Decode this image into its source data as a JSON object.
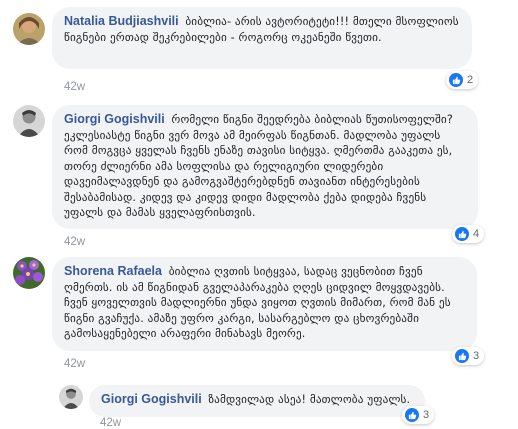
{
  "comments": [
    {
      "author": "Natalia Budjiashvili",
      "text": "ბიბლია- არის ავტორიტეტი!!! მთელი მსოფლიოს წიგნები ერთად შეკრებილები - როგორც ოკეანეში წვეთი.",
      "reaction_count": "2",
      "time": "42w"
    },
    {
      "author": "Giorgi Gogishvili",
      "text": "რომელი წიგნი შეედრება ბიბლიას წუთისოფელში? ეკლესიასტე წიგნი ვერ მოვა ამ მეირფას წიგნთან. მადლობა უფალს რომ მოგვცა ყველას ჩვენს ენაზე თავისი სიტყვა. ღმერთმა გააკეთა ეს, თორე ძლიერნი ამა სოფლისა და რელიგიური ლიდერები დავეიმალავდნენ და გამოგვაშტერებდნენ თავიანთ ინტერესების შესაბამისად. კიდევ და კიდევ დიდი მადლობა ქება დიდება ჩვენს უფალს და მამას ყველაფრისთვის.",
      "reaction_count": "4",
      "time": "42w"
    },
    {
      "author": "Shorena Rafaela",
      "text": "ბიბლია ღვთის სიტყვაა, სადაც ვეცნობით ჩვენ ღმერთს. ის ამ წიგნიდან გველაპარაკება ღღეს ციდვილ მოყვდავებს. ჩვენ ყოველთვის მადლიერნი უნდა ვიყოთ ღვთის მიმართ, რომ მან ეს წიგნი გვაჩუქა. ამაზე უფრო კარგი, სასარგებლო და ცხოვრებაში გამოსაყენებელი არაფერი მინახავს მეორე.",
      "reaction_count": "3",
      "time": "42w"
    }
  ],
  "reply": {
    "author": "Giorgi Gogishvili",
    "text": "ზამდვილად ასეა! მათლობა უფალს.",
    "reaction_count": "3",
    "time": "42w"
  },
  "colors": {
    "bubble": "#f2f3f5",
    "author": "#385898",
    "like": "#1877f2",
    "muted": "#90949c"
  }
}
